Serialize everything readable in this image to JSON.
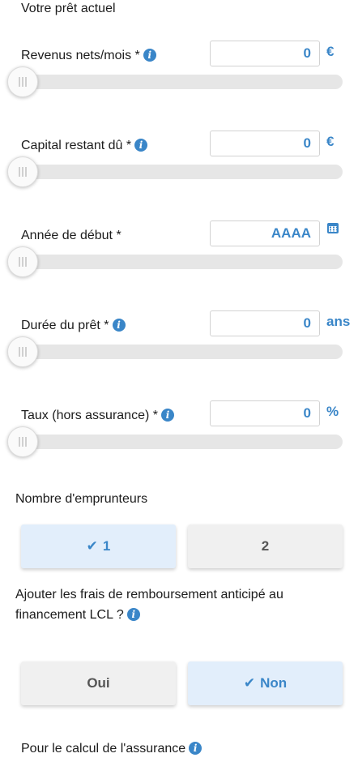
{
  "title": "Votre prêt actuel",
  "fields": [
    {
      "label": "Revenus nets/mois *",
      "value": "0",
      "unit": "€"
    },
    {
      "label": "Capital restant dû *",
      "value": "0",
      "unit": "€"
    },
    {
      "label": "Année de début *",
      "value": "AAAA",
      "unit": "calendar-icon"
    },
    {
      "label": "Durée du prêt *",
      "value": "0",
      "unit": "ans"
    },
    {
      "label": "Taux (hors assurance) *",
      "value": "0",
      "unit": "%"
    }
  ],
  "borrowers": {
    "label": "Nombre d'emprunteurs",
    "options": [
      "1",
      "2"
    ],
    "selected": "1"
  },
  "early_repayment": {
    "question": "Ajouter les frais de remboursement anticipé au financement LCL ?",
    "options": [
      "Oui",
      "Non"
    ],
    "selected": "Non"
  },
  "insurance": {
    "label": "Pour le calcul de l'assurance"
  },
  "colors": {
    "accent": "#3a86c8",
    "selected_bg": "#e2eefb",
    "unselected_bg": "#f0f0f0",
    "track": "#e6e6e6"
  }
}
